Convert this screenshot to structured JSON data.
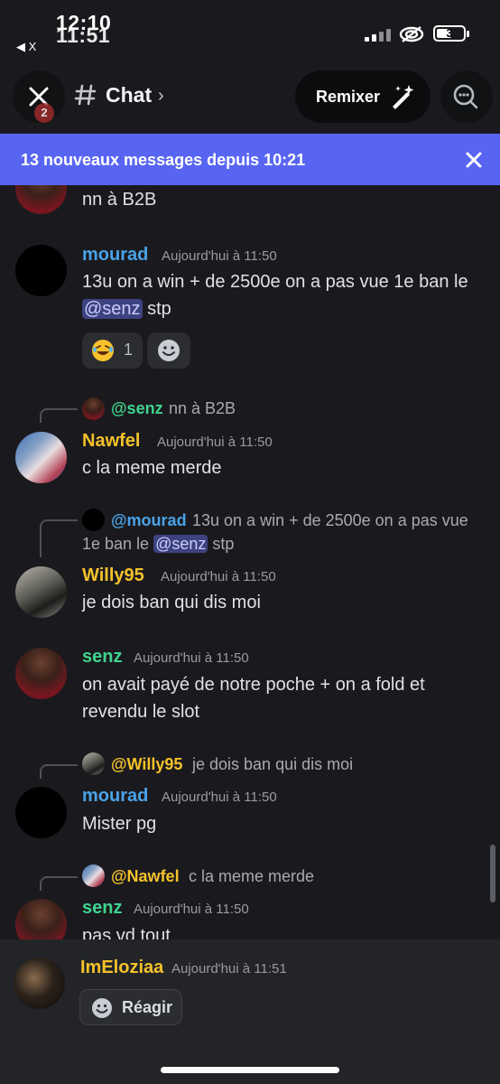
{
  "status_bar": {
    "time_primary": "12:10",
    "time_secondary": "11:51",
    "back_label": "◀ X",
    "battery": "3"
  },
  "header": {
    "badge": "2",
    "channel": "Chat",
    "remix_label": "Remixer"
  },
  "banner": {
    "text": "13 nouveaux messages depuis 10:21"
  },
  "messages": [
    {
      "text": "nn à B2B"
    },
    {
      "username": "mourad",
      "timestamp": "Aujourd'hui à 11:50",
      "text_1": "13u on a win + de 2500e on a pas vue 1e ban le",
      "mention": "@senz",
      "text_2": "stp",
      "reaction_count": "1"
    },
    {
      "reply_to": "@senz",
      "reply_text": "nn à B2B",
      "username": "Nawfel",
      "timestamp": "Aujourd'hui à 11:50",
      "text": "c la meme merde"
    },
    {
      "reply_to": "@mourad",
      "reply_text_1": "13u on a win + de 2500e on a pas vue",
      "reply_text_2": "1e ban le",
      "reply_mention": "@senz",
      "reply_text_3": "stp",
      "username": "Willy95",
      "timestamp": "Aujourd'hui à 11:50",
      "text": "je dois ban qui dis moi"
    },
    {
      "username": "senz",
      "timestamp": "Aujourd'hui à 11:50",
      "text_1": "on avait payé de notre poche + on a fold et",
      "text_2": "revendu le slot"
    },
    {
      "reply_to": "@Willy95",
      "reply_text": "je dois ban qui dis moi",
      "username": "mourad",
      "timestamp": "Aujourd'hui à 11:50",
      "text": "Mister pg"
    },
    {
      "reply_to": "@Nawfel",
      "reply_text": "c la meme merde",
      "username": "senz",
      "timestamp": "Aujourd'hui à 11:50",
      "text": "pas vd tout"
    }
  ],
  "bottom_preview": {
    "username": "ImEloziaa",
    "timestamp": "Aujourd'hui à 11:51",
    "react_label": "Réagir"
  },
  "colors": {
    "mourad": "#4aa3e8",
    "nawfel_willy_imeloziaa": "#f5c22b",
    "senz": "#3fd48e",
    "banner": "#5865f2"
  }
}
